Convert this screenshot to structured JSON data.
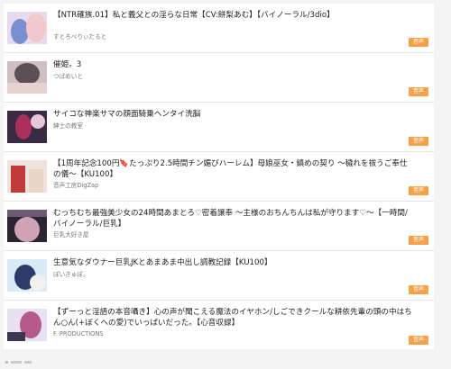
{
  "items": [
    {
      "title": "【NTR確族.01】私と義父との淫らな日常【CV:餅梨あむ】【バイノーラル/3dio】",
      "circle": "すとろべりぃたると",
      "badge": "音声",
      "thumb_colors": [
        "#e9d9ef",
        "#7a8fd0",
        "#f2c7c9"
      ]
    },
    {
      "title": "催姫。3",
      "circle": "つばめいと",
      "badge": "音声",
      "thumb_colors": [
        "#cfc0c3",
        "#5c4f55",
        "#e6d2cf"
      ]
    },
    {
      "title": "サイコな神楽サマの顔面騎乗ヘンタイ洗脳",
      "circle": "紳士の教室",
      "badge": "音声",
      "thumb_colors": [
        "#3a2b44",
        "#a8305a",
        "#e6c6d8"
      ]
    },
    {
      "title": "【1周年記念100円🔖たっぷり2.5時間チン媚びハーレム】母娘巫女・鎮めの契り ～穢れを祓うご奉仕の儀～【KU100】",
      "circle": "音声工房DigZap",
      "badge": "音声",
      "thumb_colors": [
        "#f0e2de",
        "#c23a3a",
        "#ead6c6"
      ]
    },
    {
      "title": "むっちむち最強美少女の24時間あまとろ♡密着譲奉 ～主様のおちんちんは私が守ります♡～【一時間/バイノーラル/巨乳】",
      "circle": "巨乳大好き屋",
      "badge": "音声",
      "thumb_colors": [
        "#2b2533",
        "#d0a3b5",
        "#6d5a74"
      ]
    },
    {
      "title": "生意気なダウナー巨乳JKとあまあま中出し調教記録【KU100】",
      "circle": "ぽいきゅぽ。",
      "badge": "音声",
      "thumb_colors": [
        "#d9ecf6",
        "#2c3b66",
        "#f3f0ee"
      ]
    },
    {
      "title": "【ずーっと淫語の本音囁き】心の声が聞こえる魔法のイヤホン/しごできクールな耕依先輩の頭の中はちん○ん(+ぼくへの愛)でいっぱいだった。【心音収録】",
      "circle": "F. PRODUCTIONS",
      "badge": "音声",
      "thumb_colors": [
        "#e7e1f2",
        "#b55a8a",
        "#3d3550"
      ]
    }
  ]
}
